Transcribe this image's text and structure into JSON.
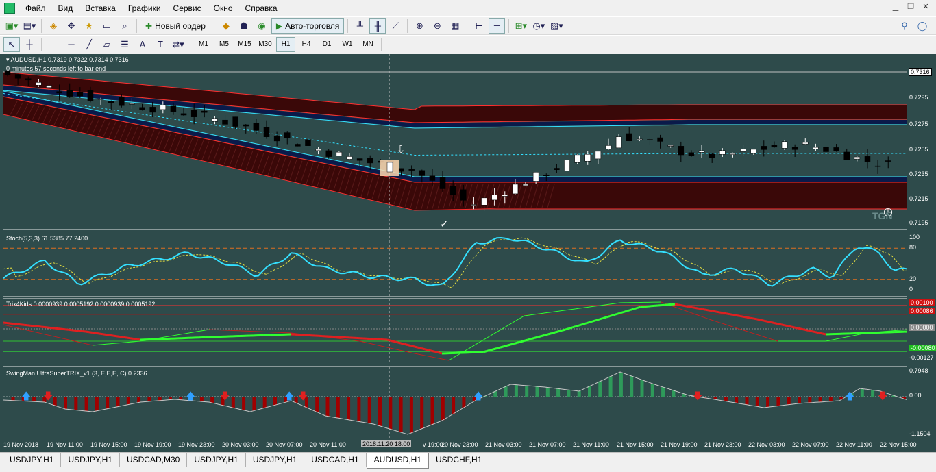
{
  "menu": [
    "Файл",
    "Вид",
    "Вставка",
    "Графики",
    "Сервис",
    "Окно",
    "Справка"
  ],
  "toolbar1": {
    "new_order": "Новый ордер",
    "autotrading": "Авто-торговля"
  },
  "timeframes": [
    "M1",
    "M5",
    "M15",
    "M30",
    "H1",
    "H4",
    "D1",
    "W1",
    "MN"
  ],
  "active_timeframe": "H1",
  "main_chart": {
    "title": "AUDUSD,H1  0.7319 0.7322 0.7314 0.7316",
    "subtitle": "0 minutes 57 seconds left to bar end",
    "price_labels": [
      "0.7316",
      "0.7295",
      "0.7275",
      "0.7255",
      "0.7235",
      "0.7215",
      "0.7195"
    ],
    "current_price": "0.7316",
    "watermark": "TGN",
    "colors": {
      "bull": "#ffffff",
      "bear": "#000000",
      "band_fill": "#3a0808",
      "band_line": "#ff3030",
      "inner_line": "#34e0ff",
      "mid_dash": "#34e0ff"
    }
  },
  "stoch": {
    "title": "Stoch(5,3,3) 61.5385 77.2400",
    "levels": [
      "100",
      "80",
      "20",
      "0"
    ],
    "colors": {
      "main": "#34e0ff",
      "signal": "#e8e040",
      "level": "#e07020"
    }
  },
  "trix": {
    "title": "Trix4Kids 0.0000939 0.0005192 0.0000939 0.0005192",
    "labels": [
      "0.00100",
      "0.00086",
      "0.00000",
      "-0.00080",
      "-0.00127"
    ]
  },
  "swingman": {
    "title": "SwingMan UltraSuperTRIX_v1 (3, E,E,E, C) 0.2336",
    "labels": [
      "0.7948",
      "0.00",
      "-1.1504"
    ]
  },
  "time_axis": {
    "labels": [
      "19 Nov 2018",
      "19 Nov 11:00",
      "19 Nov 15:00",
      "19 Nov 19:00",
      "19 Nov 23:00",
      "20 Nov 03:00",
      "20 Nov 07:00",
      "20 Nov 11:00",
      "v 19:00",
      "20 Nov 23:00",
      "21 Nov 03:00",
      "21 Nov 07:00",
      "21 Nov 11:00",
      "21 Nov 15:00",
      "21 Nov 19:00",
      "21 Nov 23:00",
      "22 Nov 03:00",
      "22 Nov 07:00",
      "22 Nov 11:00",
      "22 Nov 15:00"
    ],
    "cursor": "2018.11.20 18:00"
  },
  "tabs": [
    "USDJPY,H1",
    "USDJPY,H1",
    "USDCAD,M30",
    "USDJPY,H1",
    "USDJPY,H1",
    "USDCAD,H1",
    "AUDUSD,H1",
    "USDCHF,H1"
  ],
  "active_tab_index": 6
}
